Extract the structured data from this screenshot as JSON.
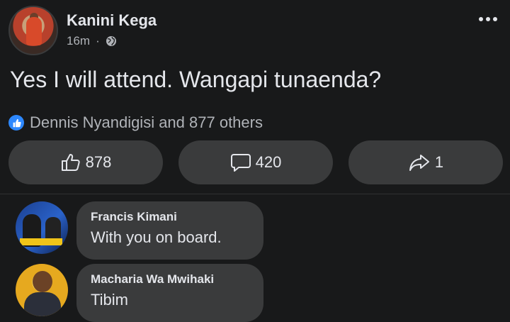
{
  "post": {
    "author": "Kanini Kega",
    "time": "16m",
    "separator": "·",
    "text": "Yes I will attend. Wangapi tunaenda?",
    "reactions_summary": "Dennis Nyandigisi and 877 others"
  },
  "actions": {
    "like_count": "878",
    "comment_count": "420",
    "share_count": "1"
  },
  "comments": [
    {
      "name": "Francis Kimani",
      "text": "With you on board."
    },
    {
      "name": "Macharia Wa Mwihaki",
      "text": "Tibim"
    }
  ],
  "icons": {
    "more": "more-options-icon",
    "privacy": "globe-icon",
    "reaction": "like-badge-icon",
    "like": "thumbs-up-icon",
    "comment": "comment-bubble-icon",
    "share": "share-arrow-icon"
  },
  "colors": {
    "background": "#18191a",
    "surface": "#3a3b3c",
    "text": "#e4e6eb",
    "secondary_text": "#b0b3b8",
    "like_blue": "#2d88ff"
  }
}
